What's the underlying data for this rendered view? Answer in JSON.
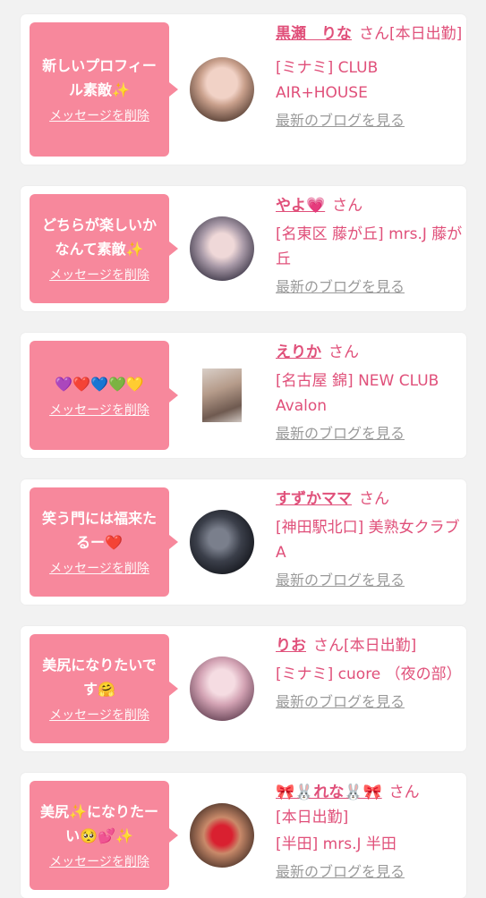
{
  "delete_label": "メッセージを削除",
  "blog_label": "最新のブログを見る",
  "san_label": "さん",
  "cards": [
    {
      "message": "新しいプロフィール素敵✨",
      "name": "黒瀬　りな",
      "after_name": "さん[本日出勤]",
      "shop": "[ミナミ] CLUB AIR+HOUSE"
    },
    {
      "message": "どちらが楽しいかなんて素敵✨",
      "name": "やよ💗",
      "after_name": "さん",
      "shop": "[名東区 藤が丘] mrs.J 藤が丘"
    },
    {
      "message": "💜❤️💙💚💛",
      "name": "えりか",
      "after_name": "さん",
      "shop": "[名古屋 錦] NEW CLUB Avalon"
    },
    {
      "message": "笑う門には福来たるー❤️",
      "name": "すずかママ",
      "after_name": "さん",
      "shop": "[神田駅北口] 美熟女クラブA"
    },
    {
      "message": "美尻になりたいです🤗",
      "name": "りお",
      "after_name": "さん[本日出勤]",
      "shop": "[ミナミ] cuore （夜の部）"
    },
    {
      "message": "美尻✨になりたーい🥺💕✨",
      "name": "🎀🐰れな🐰🎀",
      "after_name": "さん",
      "shop": "[本日出勤]",
      "shop2": "[半田] mrs.J 半田"
    }
  ]
}
